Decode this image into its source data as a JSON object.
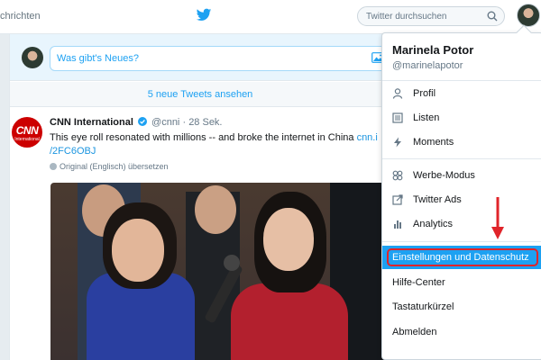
{
  "topbar": {
    "nav_messages": "chrichten",
    "search_placeholder": "Twitter durchsuchen"
  },
  "compose": {
    "placeholder": "Was gibt's Neues?"
  },
  "timeline": {
    "new_tweets": "5 neue Tweets ansehen"
  },
  "tweet": {
    "logo_text": "CNN",
    "logo_sub": "International",
    "author": "CNN International",
    "handle": "@cnni",
    "separator": "·",
    "time": "28 Sek.",
    "text": "This eye roll resonated with millions -- and broke the internet in China",
    "link_1": "cnn.i",
    "link_2": "/2FC6OBJ",
    "translation_note": "Original (Englisch) übersetzen"
  },
  "menu": {
    "user_name": "Marinela Potor",
    "user_handle": "@marinelapotor",
    "group_1": [
      {
        "label": "Profil",
        "icon": "person-icon"
      },
      {
        "label": "Listen",
        "icon": "list-icon"
      },
      {
        "label": "Moments",
        "icon": "lightning-icon"
      }
    ],
    "group_2": [
      {
        "label": "Werbe-Modus",
        "icon": "ads-mode-icon"
      },
      {
        "label": "Twitter Ads",
        "icon": "external-link-icon"
      },
      {
        "label": "Analytics",
        "icon": "bar-chart-icon"
      }
    ],
    "settings": "Einstellungen und Datenschutz",
    "group_3": [
      "Hilfe-Center",
      "Tastaturkürzel",
      "Abmelden"
    ]
  },
  "colors": {
    "accent": "#1da1f2",
    "highlight_outline": "#e0242a",
    "annotation_arrow": "#e0242a",
    "cnn_red": "#cc0000"
  }
}
